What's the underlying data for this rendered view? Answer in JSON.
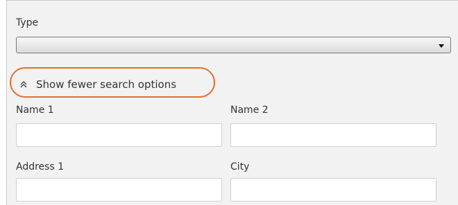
{
  "form": {
    "type_label": "Type",
    "type_value": "",
    "toggle_label": "Show fewer search options",
    "fields": {
      "name1_label": "Name 1",
      "name1_value": "",
      "name2_label": "Name 2",
      "name2_value": "",
      "address1_label": "Address 1",
      "address1_value": "",
      "city_label": "City",
      "city_value": ""
    }
  },
  "icons": {
    "toggle_icon": "double-chevron-up-icon",
    "select_icon": "dropdown-arrow-icon"
  },
  "colors": {
    "highlight": "#e07030",
    "panel_background": "#f2f2f2"
  }
}
